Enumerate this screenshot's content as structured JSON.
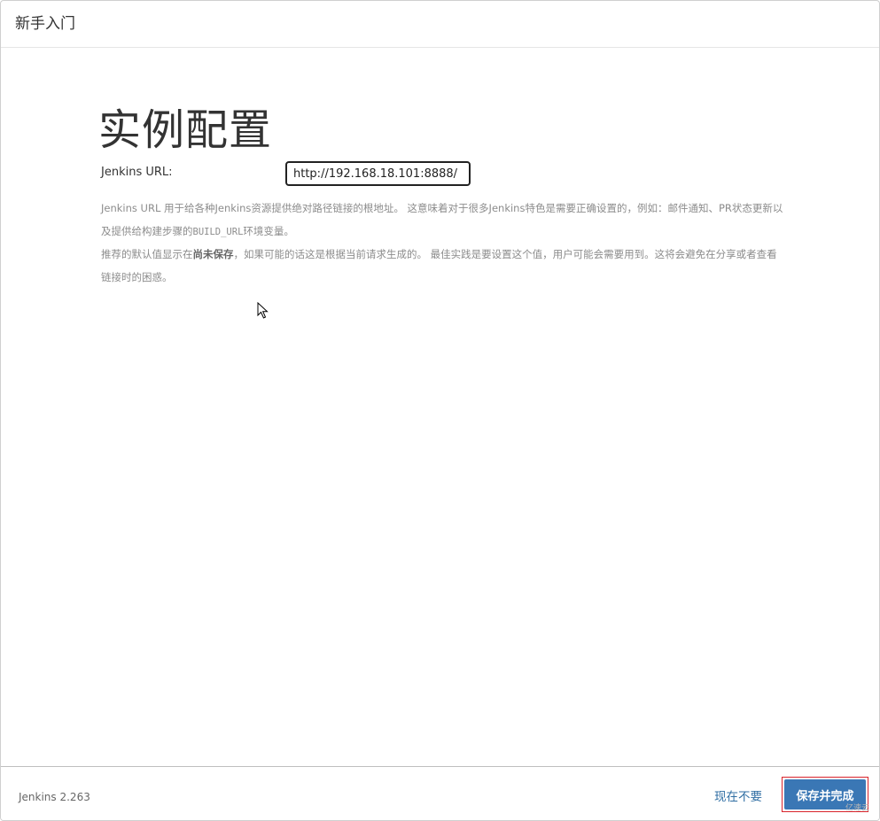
{
  "header": {
    "title": "新手入门"
  },
  "main": {
    "title": "实例配置",
    "url_label": "Jenkins URL:",
    "url_value": "http://192.168.18.101:8888/",
    "help": {
      "p1_text": "Jenkins URL 用于给各种Jenkins资源提供绝对路径链接的根地址。 这意味着对于很多Jenkins特色是需要正确设置的，例如：邮件通知、PR状态更新以及提供给构建步骤的",
      "p1_code": "BUILD_URL",
      "p1_tail": "环境变量。",
      "p2_pre": "推荐的默认值显示在",
      "p2_bold": "尚未保存",
      "p2_post": "，如果可能的话这是根据当前请求生成的。 最佳实践是要设置这个值，用户可能会需要用到。这将会避免在分享或者查看链接时的困惑。"
    }
  },
  "footer": {
    "version": "Jenkins 2.263",
    "skip_label": "现在不要",
    "save_label": "保存并完成"
  },
  "watermark": "亿速云",
  "icons": {
    "cursor": "mouse-pointer-icon"
  },
  "colors": {
    "primary_button": "#3a77b5",
    "link": "#2f6ea3",
    "highlight_border": "#d9232b"
  }
}
